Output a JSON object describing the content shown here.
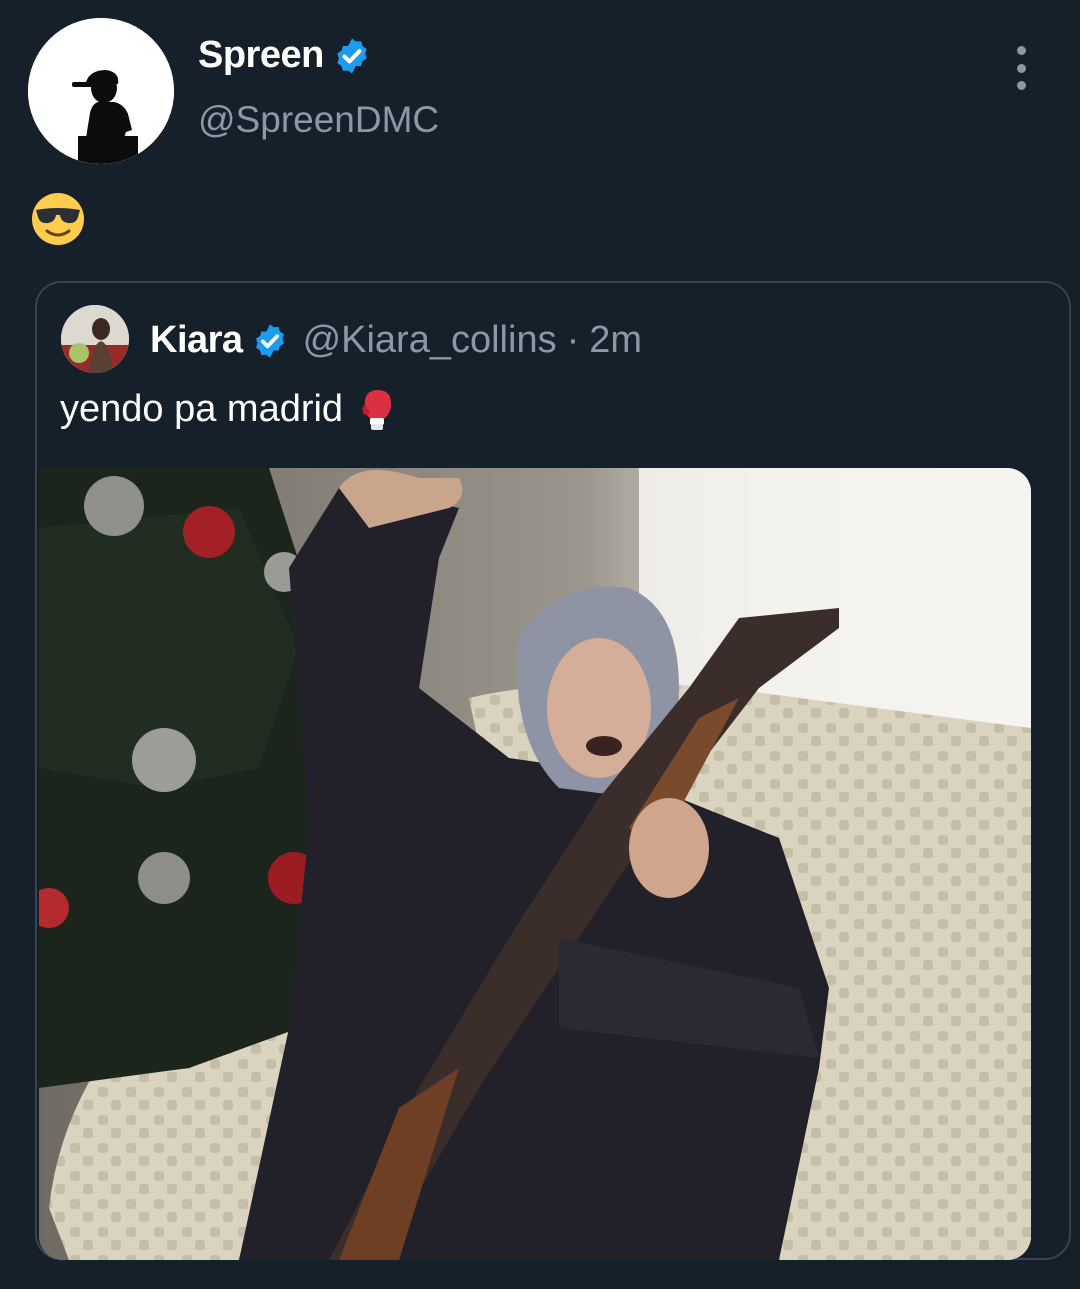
{
  "tweet": {
    "author": {
      "display_name": "Spreen",
      "handle": "@SpreenDMC",
      "verified": true
    },
    "body_emoji": "smiling-face-with-sunglasses",
    "menu_icon": "more-vertical-icon"
  },
  "quoted_tweet": {
    "author": {
      "display_name": "Kiara",
      "handle": "@Kiara_collins",
      "verified": true
    },
    "separator": "·",
    "time": "2m",
    "text": "yendo pa madrid",
    "text_emoji": "boxing-glove",
    "media": "photo"
  },
  "colors": {
    "background": "#15202b",
    "secondary_text": "#8b98a5",
    "border": "#38444d",
    "verified_blue": "#1d9bf0"
  }
}
